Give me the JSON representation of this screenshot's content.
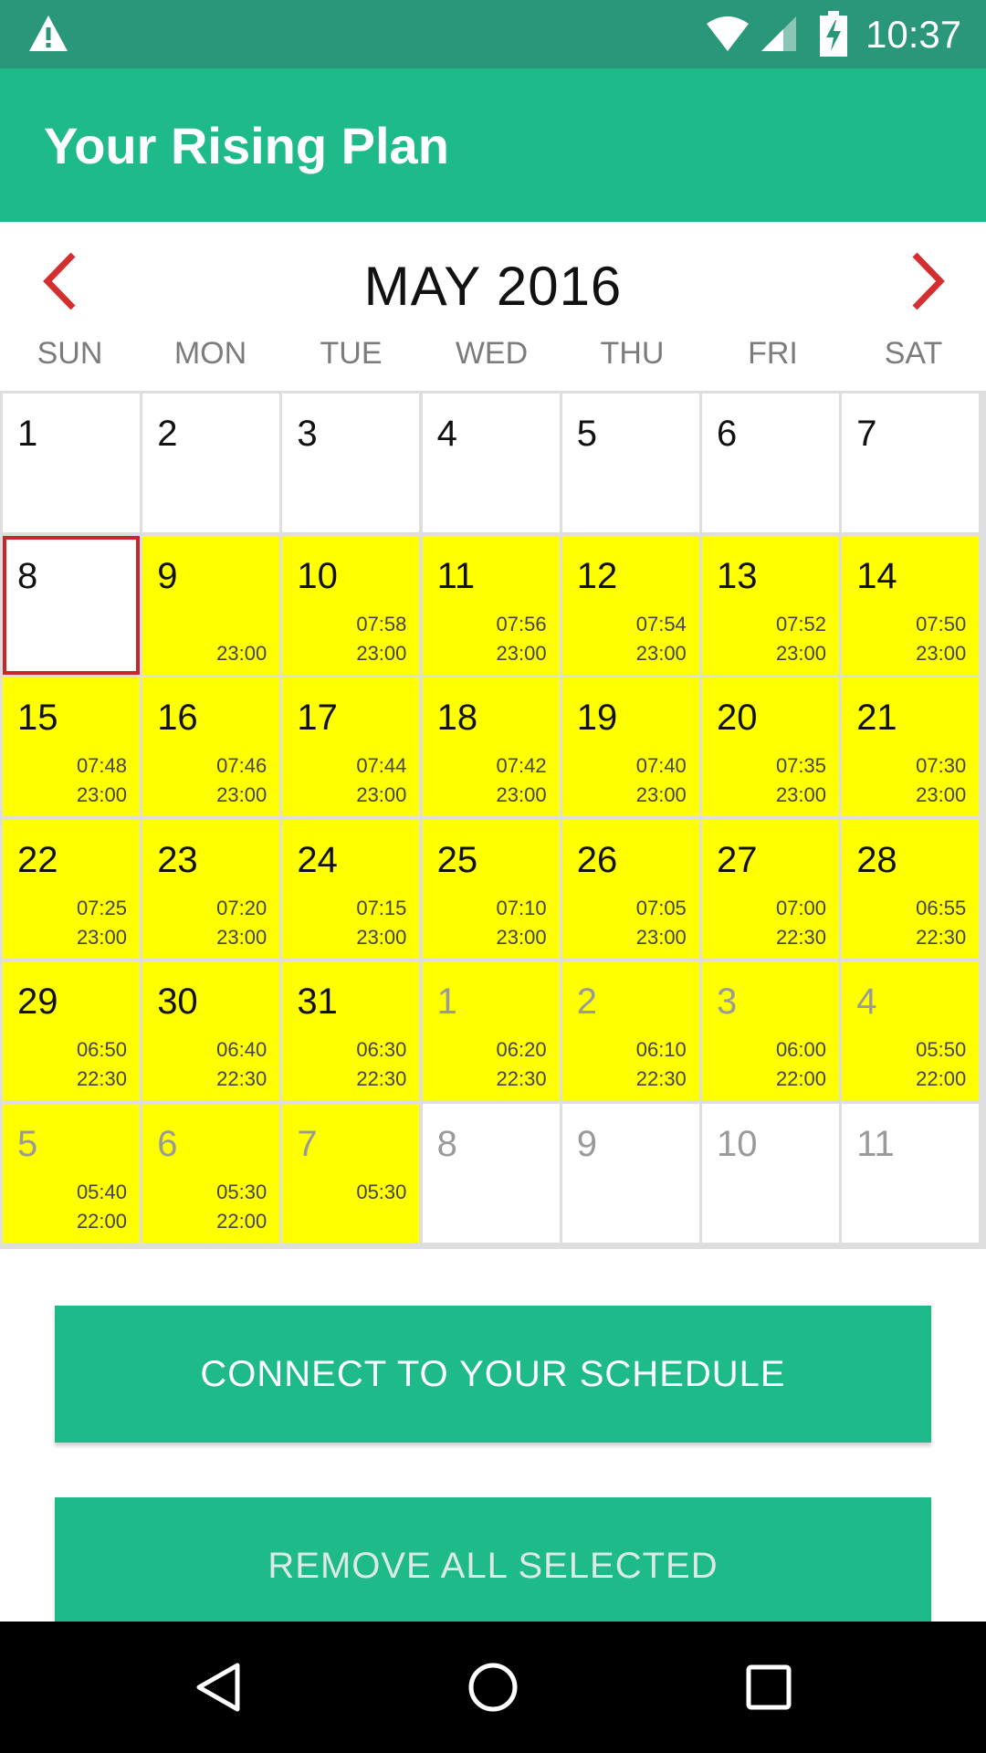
{
  "status_bar": {
    "time": "10:37",
    "icons": [
      "warning-icon",
      "wifi-icon",
      "signal-icon",
      "battery-charging-icon"
    ]
  },
  "app_bar": {
    "title": "Your Rising Plan"
  },
  "calendar": {
    "month_title": "MAY 2016",
    "prev_icon": "chevron-left-icon",
    "next_icon": "chevron-right-icon",
    "weekdays": [
      "SUN",
      "MON",
      "TUE",
      "WED",
      "THU",
      "FRI",
      "SAT"
    ],
    "days": [
      {
        "day": "1"
      },
      {
        "day": "2"
      },
      {
        "day": "3"
      },
      {
        "day": "4"
      },
      {
        "day": "5"
      },
      {
        "day": "6"
      },
      {
        "day": "7"
      },
      {
        "day": "8",
        "today": true
      },
      {
        "day": "9",
        "highlight": true,
        "times": [
          "",
          "23:00"
        ]
      },
      {
        "day": "10",
        "highlight": true,
        "times": [
          "07:58",
          "23:00"
        ]
      },
      {
        "day": "11",
        "highlight": true,
        "times": [
          "07:56",
          "23:00"
        ]
      },
      {
        "day": "12",
        "highlight": true,
        "times": [
          "07:54",
          "23:00"
        ]
      },
      {
        "day": "13",
        "highlight": true,
        "times": [
          "07:52",
          "23:00"
        ]
      },
      {
        "day": "14",
        "highlight": true,
        "times": [
          "07:50",
          "23:00"
        ]
      },
      {
        "day": "15",
        "highlight": true,
        "times": [
          "07:48",
          "23:00"
        ]
      },
      {
        "day": "16",
        "highlight": true,
        "times": [
          "07:46",
          "23:00"
        ]
      },
      {
        "day": "17",
        "highlight": true,
        "times": [
          "07:44",
          "23:00"
        ]
      },
      {
        "day": "18",
        "highlight": true,
        "times": [
          "07:42",
          "23:00"
        ]
      },
      {
        "day": "19",
        "highlight": true,
        "times": [
          "07:40",
          "23:00"
        ]
      },
      {
        "day": "20",
        "highlight": true,
        "times": [
          "07:35",
          "23:00"
        ]
      },
      {
        "day": "21",
        "highlight": true,
        "times": [
          "07:30",
          "23:00"
        ]
      },
      {
        "day": "22",
        "highlight": true,
        "times": [
          "07:25",
          "23:00"
        ]
      },
      {
        "day": "23",
        "highlight": true,
        "times": [
          "07:20",
          "23:00"
        ]
      },
      {
        "day": "24",
        "highlight": true,
        "times": [
          "07:15",
          "23:00"
        ]
      },
      {
        "day": "25",
        "highlight": true,
        "times": [
          "07:10",
          "23:00"
        ]
      },
      {
        "day": "26",
        "highlight": true,
        "times": [
          "07:05",
          "23:00"
        ]
      },
      {
        "day": "27",
        "highlight": true,
        "times": [
          "07:00",
          "22:30"
        ]
      },
      {
        "day": "28",
        "highlight": true,
        "times": [
          "06:55",
          "22:30"
        ]
      },
      {
        "day": "29",
        "highlight": true,
        "times": [
          "06:50",
          "22:30"
        ]
      },
      {
        "day": "30",
        "highlight": true,
        "times": [
          "06:40",
          "22:30"
        ]
      },
      {
        "day": "31",
        "highlight": true,
        "times": [
          "06:30",
          "22:30"
        ]
      },
      {
        "day": "1",
        "other_month": true,
        "highlight": true,
        "times": [
          "06:20",
          "22:30"
        ]
      },
      {
        "day": "2",
        "other_month": true,
        "highlight": true,
        "times": [
          "06:10",
          "22:30"
        ]
      },
      {
        "day": "3",
        "other_month": true,
        "highlight": true,
        "times": [
          "06:00",
          "22:00"
        ]
      },
      {
        "day": "4",
        "other_month": true,
        "highlight": true,
        "times": [
          "05:50",
          "22:00"
        ]
      },
      {
        "day": "5",
        "other_month": true,
        "highlight": true,
        "times": [
          "05:40",
          "22:00"
        ]
      },
      {
        "day": "6",
        "other_month": true,
        "highlight": true,
        "times": [
          "05:30",
          "22:00"
        ]
      },
      {
        "day": "7",
        "other_month": true,
        "highlight": true,
        "times": [
          "05:30",
          ""
        ]
      },
      {
        "day": "8",
        "other_month": true
      },
      {
        "day": "9",
        "other_month": true
      },
      {
        "day": "10",
        "other_month": true
      },
      {
        "day": "11",
        "other_month": true
      }
    ]
  },
  "buttons": {
    "connect": "CONNECT TO YOUR SCHEDULE",
    "remove": "REMOVE ALL SELECTED"
  },
  "nav_bar": {
    "icons": [
      "back-icon",
      "home-icon",
      "recents-icon"
    ]
  },
  "colors": {
    "status_bar": "#2a967a",
    "accent": "#1fba8a",
    "highlight": "#ffff00",
    "today_border": "#c8262b",
    "arrow": "#d32f2f"
  }
}
